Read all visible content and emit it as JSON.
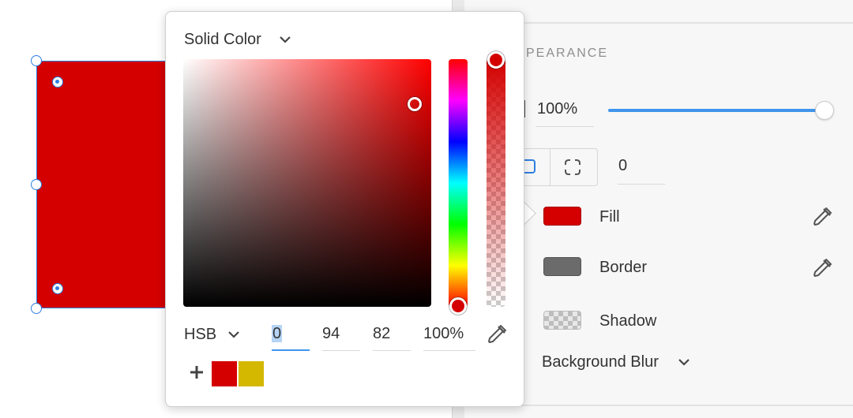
{
  "canvas": {
    "shape_color": "#d40000",
    "selection_color": "#2f7fe0"
  },
  "panel": {
    "section_label": "PEARANCE",
    "opacity_value": "100%",
    "opacity_fraction": 1.0,
    "corner_radius_value": "0",
    "effects": [
      {
        "label": "Fill",
        "swatch_color": "#d40000",
        "has_dropper": true
      },
      {
        "label": "Border",
        "swatch_color": "#6b6b6b",
        "has_dropper": true
      },
      {
        "label": "Shadow",
        "swatch_color": "checker",
        "has_dropper": false
      }
    ],
    "background_blur_label": "Background Blur",
    "accent_color": "#3f95ec"
  },
  "picker": {
    "mode_label": "Solid Color",
    "color_space_label": "HSB",
    "h_value": "0",
    "s_value": "94",
    "b_value": "82",
    "alpha_value": "100%",
    "current_color": "#d40000",
    "doc_swatches": [
      "#d40000",
      "#d4b800"
    ],
    "icons": {
      "mode": "chevron-down-icon",
      "space": "chevron-down-icon",
      "dropper": "eyedropper-icon",
      "add": "plus-icon"
    }
  }
}
